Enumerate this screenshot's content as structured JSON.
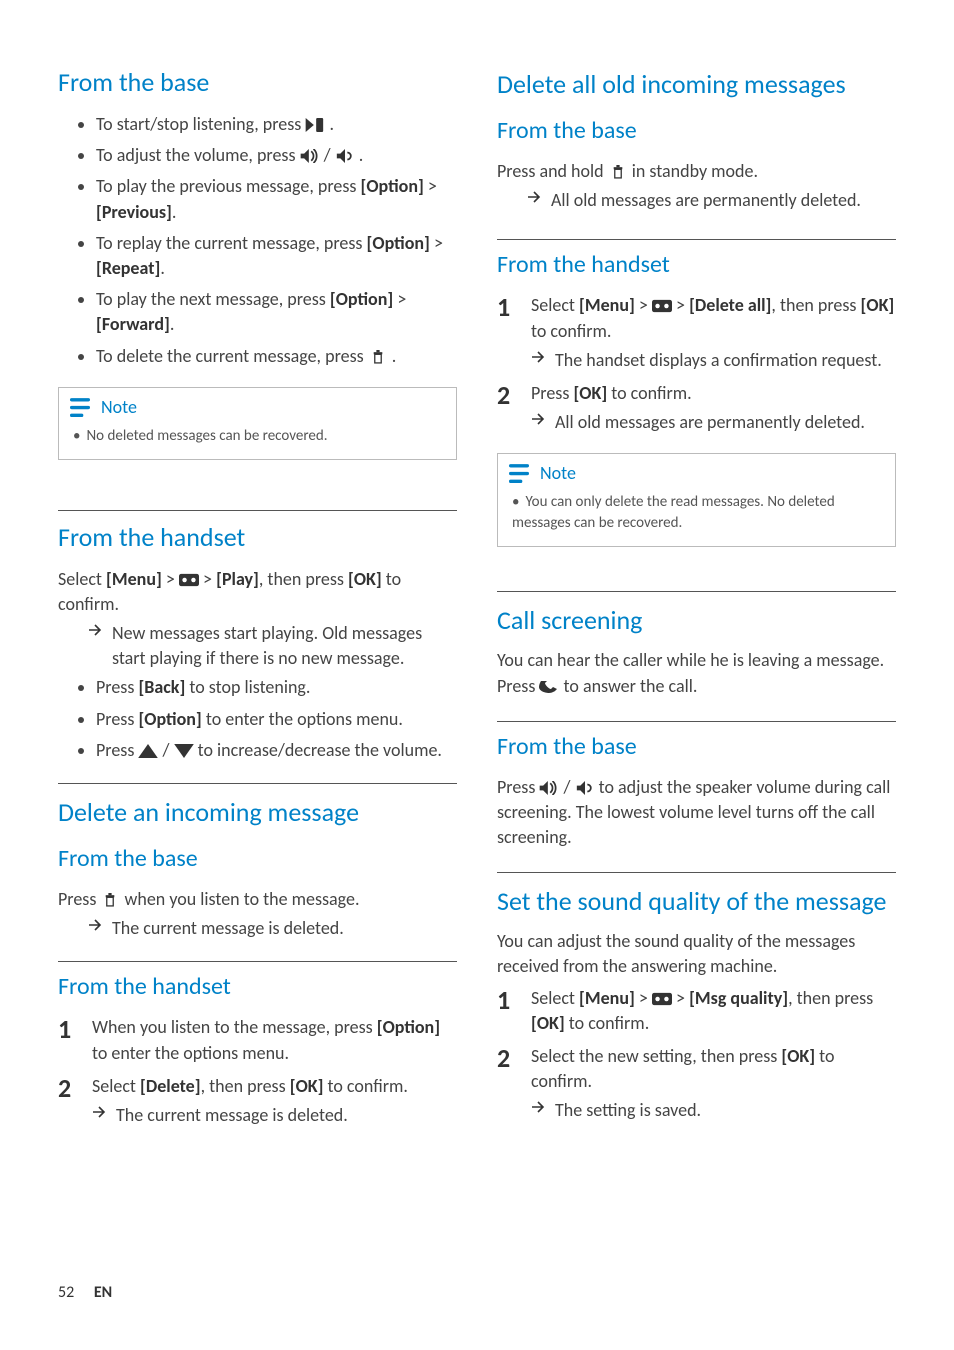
{
  "page_number": "52",
  "language_code": "EN",
  "left_col": {
    "s1": {
      "title": "From the base",
      "bullets": {
        "b1": {
          "pre": "To start/stop listening, press ",
          "post": " ."
        },
        "b2": {
          "pre": "To adjust the volume, press ",
          "mid": " / ",
          "post": " ."
        },
        "b3": {
          "pre": "To play the previous message, press ",
          "bold1": "[Option]",
          "gt": " > ",
          "bold2": "[Previous]",
          "post": "."
        },
        "b4": {
          "pre": "To replay the current message, press ",
          "bold1": "[Option]",
          "gt": " > ",
          "bold2": "[Repeat]",
          "post": "."
        },
        "b5": {
          "pre": "To play the next message, press ",
          "bold1": "[Option]",
          "gt": " > ",
          "bold2": "[Forward]",
          "post": "."
        },
        "b6": {
          "pre": "To delete the current message, press ",
          "post": " ."
        }
      },
      "note_label": "Note",
      "note_text": "No deleted messages can be recovered."
    },
    "s2": {
      "title": "From the handset",
      "intro": {
        "pre": "Select ",
        "b1": "[Menu]",
        "gt1": " > ",
        "gt2": " > ",
        "b2": "[Play]",
        "mid": ", then press ",
        "b3": "[OK]",
        "post": " to confirm."
      },
      "result": "New messages start playing. Old messages start playing if there is no new message.",
      "bullets": {
        "b1": {
          "pre": "Press ",
          "bold": "[Back]",
          "post": " to stop listening."
        },
        "b2": {
          "pre": "Press ",
          "bold": "[Option]",
          "post": " to enter the options menu."
        },
        "b3": {
          "pre": "Press ",
          "mid": " / ",
          "post": " to increase/decrease the volume."
        }
      }
    },
    "s3": {
      "title_main": "Delete an incoming message",
      "base_title": "From the base",
      "base_text": {
        "pre": "Press ",
        "post": " when you listen to the message."
      },
      "base_result": "The current message is deleted.",
      "handset_title": "From the handset",
      "steps": {
        "st1": {
          "num": "1",
          "pre": "When you listen to the message, press ",
          "bold": "[Option]",
          "post": " to enter the options menu."
        },
        "st2": {
          "num": "2",
          "pre": "Select ",
          "bold1": "[Delete]",
          "mid": ", then press ",
          "bold2": "[OK]",
          "post": " to confirm."
        }
      },
      "step_result": "The current message is deleted."
    }
  },
  "right_col": {
    "s1": {
      "title_main": "Delete all old incoming messages",
      "base_title": "From the base",
      "base_text": {
        "pre": "Press and hold ",
        "post": " in standby mode."
      },
      "base_result": "All old messages are permanently deleted.",
      "handset_title": "From the handset",
      "steps": {
        "st1": {
          "num": "1",
          "pre": "Select ",
          "b1": "[Menu]",
          "gt1": " > ",
          "gt2": " > ",
          "b2": "[Delete all]",
          "mid": ", then press ",
          "b3": "[OK]",
          "post": " to confirm."
        },
        "st1_result": "The handset displays a confirmation request.",
        "st2": {
          "num": "2",
          "pre": "Press ",
          "bold": "[OK]",
          "post": " to confirm."
        },
        "st2_result": "All old messages are permanently deleted."
      },
      "note_label": "Note",
      "note_text": "You can only delete the read messages. No deleted messages can be recovered."
    },
    "s2": {
      "title_main": "Call screening",
      "intro": {
        "pre": "You can hear the caller while he is leaving a message. Press ",
        "post": " to answer the call."
      },
      "base_title": "From the base",
      "base_text": {
        "pre": "Press ",
        "mid": " / ",
        "post": " to adjust the speaker volume during call screening. The lowest volume level turns off the call screening."
      }
    },
    "s3": {
      "title_main": "Set the sound quality of the message",
      "intro": "You can adjust the sound quality of the messages received from the answering machine.",
      "steps": {
        "st1": {
          "num": "1",
          "pre": "Select ",
          "b1": "[Menu]",
          "gt1": " > ",
          "gt2": " > ",
          "b2": "[Msg quality]",
          "mid": ", then press ",
          "b3": "[OK]",
          "post": " to confirm."
        },
        "st2": {
          "num": "2",
          "pre": "Select the new setting, then press ",
          "bold": "[OK]",
          "post": " to confirm."
        }
      },
      "step_result": "The setting is saved."
    }
  }
}
